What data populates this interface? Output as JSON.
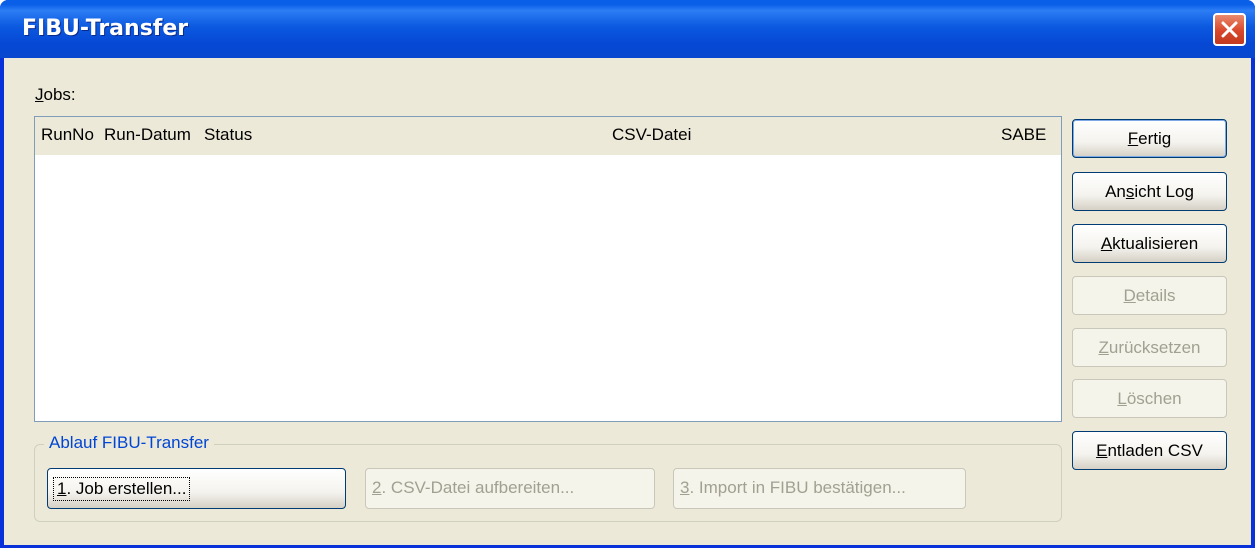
{
  "window": {
    "title": "FIBU-Transfer",
    "close_icon": "close-icon"
  },
  "jobs": {
    "label_mnemonic": "J",
    "label_rest": "obs:",
    "columns": [
      "RunNo",
      "Run-Datum",
      "Status",
      "CSV-Datei",
      "SABE"
    ],
    "rows": []
  },
  "side_buttons": [
    {
      "pre": "",
      "mnemonic": "F",
      "post": "ertig",
      "enabled": true
    },
    {
      "pre": "An",
      "mnemonic": "s",
      "post": "icht Log",
      "enabled": true
    },
    {
      "pre": "",
      "mnemonic": "A",
      "post": "ktualisieren",
      "enabled": true
    },
    {
      "pre": "",
      "mnemonic": "D",
      "post": "etails",
      "enabled": false
    },
    {
      "pre": "",
      "mnemonic": "Z",
      "post": "urücksetzen",
      "enabled": false
    },
    {
      "pre": "",
      "mnemonic": "L",
      "post": "öschen",
      "enabled": false
    },
    {
      "pre": "",
      "mnemonic": "E",
      "post": "ntladen CSV",
      "enabled": true
    }
  ],
  "workflow": {
    "title": "Ablauf FIBU-Transfer",
    "steps": [
      {
        "mnemonic": "1",
        "post": ". Job erstellen...",
        "enabled": true
      },
      {
        "mnemonic": "2",
        "post": ". CSV-Datei aufbereiten...",
        "enabled": false
      },
      {
        "mnemonic": "3",
        "post": ". Import in FIBU bestätigen...",
        "enabled": false
      }
    ]
  },
  "colors": {
    "titlebar": "#0a5fe8",
    "dialog_bg": "#ece9d8",
    "group_title": "#0046d5",
    "disabled_text": "#a1a192"
  }
}
